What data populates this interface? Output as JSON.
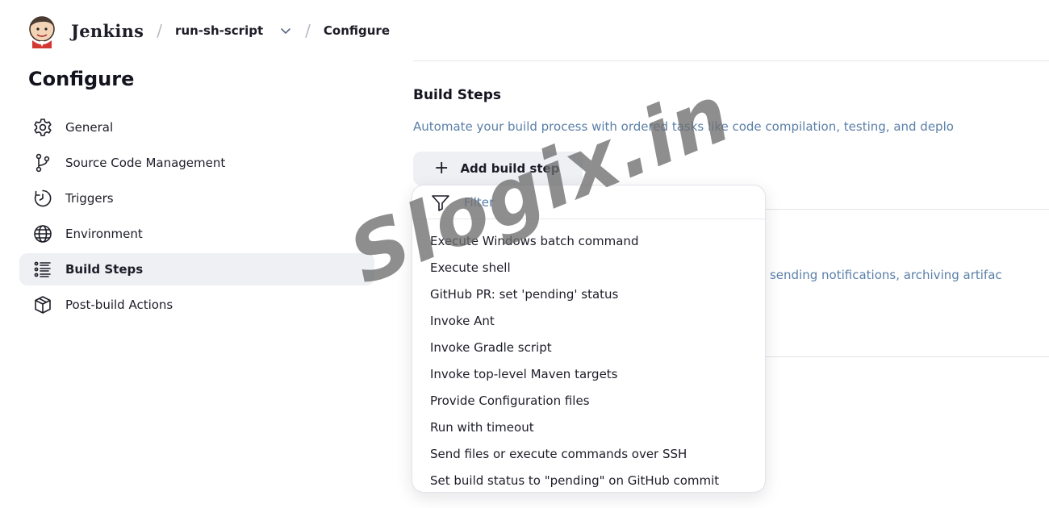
{
  "header": {
    "brand": "Jenkins",
    "breadcrumbs": [
      {
        "label": "run-sh-script"
      },
      {
        "label": "Configure"
      }
    ]
  },
  "sidebar": {
    "title": "Configure",
    "items": [
      {
        "label": "General",
        "icon": "gear-icon"
      },
      {
        "label": "Source Code Management",
        "icon": "git-branch-icon"
      },
      {
        "label": "Triggers",
        "icon": "timer-icon"
      },
      {
        "label": "Environment",
        "icon": "globe-icon"
      },
      {
        "label": "Build Steps",
        "icon": "list-icon",
        "active": true
      },
      {
        "label": "Post-build Actions",
        "icon": "package-icon"
      }
    ]
  },
  "main": {
    "build_steps": {
      "title": "Build Steps",
      "description": "Automate your build process with ordered tasks like code compilation, testing, and deplo",
      "add_button": "Add build step"
    },
    "post_build": {
      "description": "e sending notifications, archiving artifac"
    }
  },
  "dropdown": {
    "filter_placeholder": "Filter",
    "items": [
      "Execute Windows batch command",
      "Execute shell",
      "GitHub PR: set 'pending' status",
      "Invoke Ant",
      "Invoke Gradle script",
      "Invoke top-level Maven targets",
      "Provide Configuration files",
      "Run with timeout",
      "Send files or execute commands over SSH",
      "Set build status to \"pending\" on GitHub commit"
    ]
  },
  "watermark": "Slogix.in",
  "colors": {
    "accent_text": "#5a7fa8",
    "active_bg": "#eef0f4"
  }
}
